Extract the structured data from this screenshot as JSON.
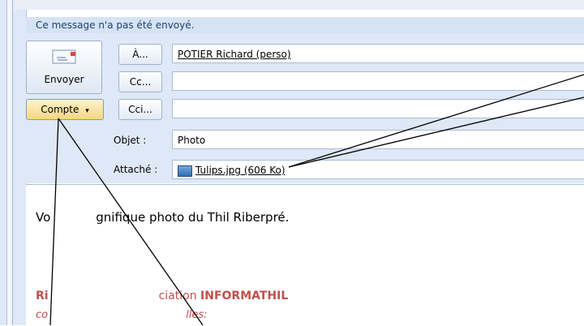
{
  "notice": "Ce message n'a pas été envoyé.",
  "buttons": {
    "send": "Envoyer",
    "compte": "Compte",
    "to": "À...",
    "cc": "Cc...",
    "bcc": "Cci..."
  },
  "fields": {
    "to_value": "POTIER Richard (perso)",
    "cc_value": "",
    "bcc_value": "",
    "subject_label": "Objet :",
    "subject_value": "Photo",
    "attached_label": "Attaché :",
    "attachment": "Tulips.jpg (606 Ko)"
  },
  "body": {
    "line1_start": "Vo",
    "line1_end": "gnifique photo du Thil Riberpré.",
    "sig_start": "Ri",
    "sig_mid": "ciation ",
    "sig_org": "INFORMATHIL",
    "sub_start": "co",
    "sub_end": "lles:"
  },
  "icons": [
    "send-icon",
    "dropdown-arrow-icon",
    "image-file-icon"
  ]
}
